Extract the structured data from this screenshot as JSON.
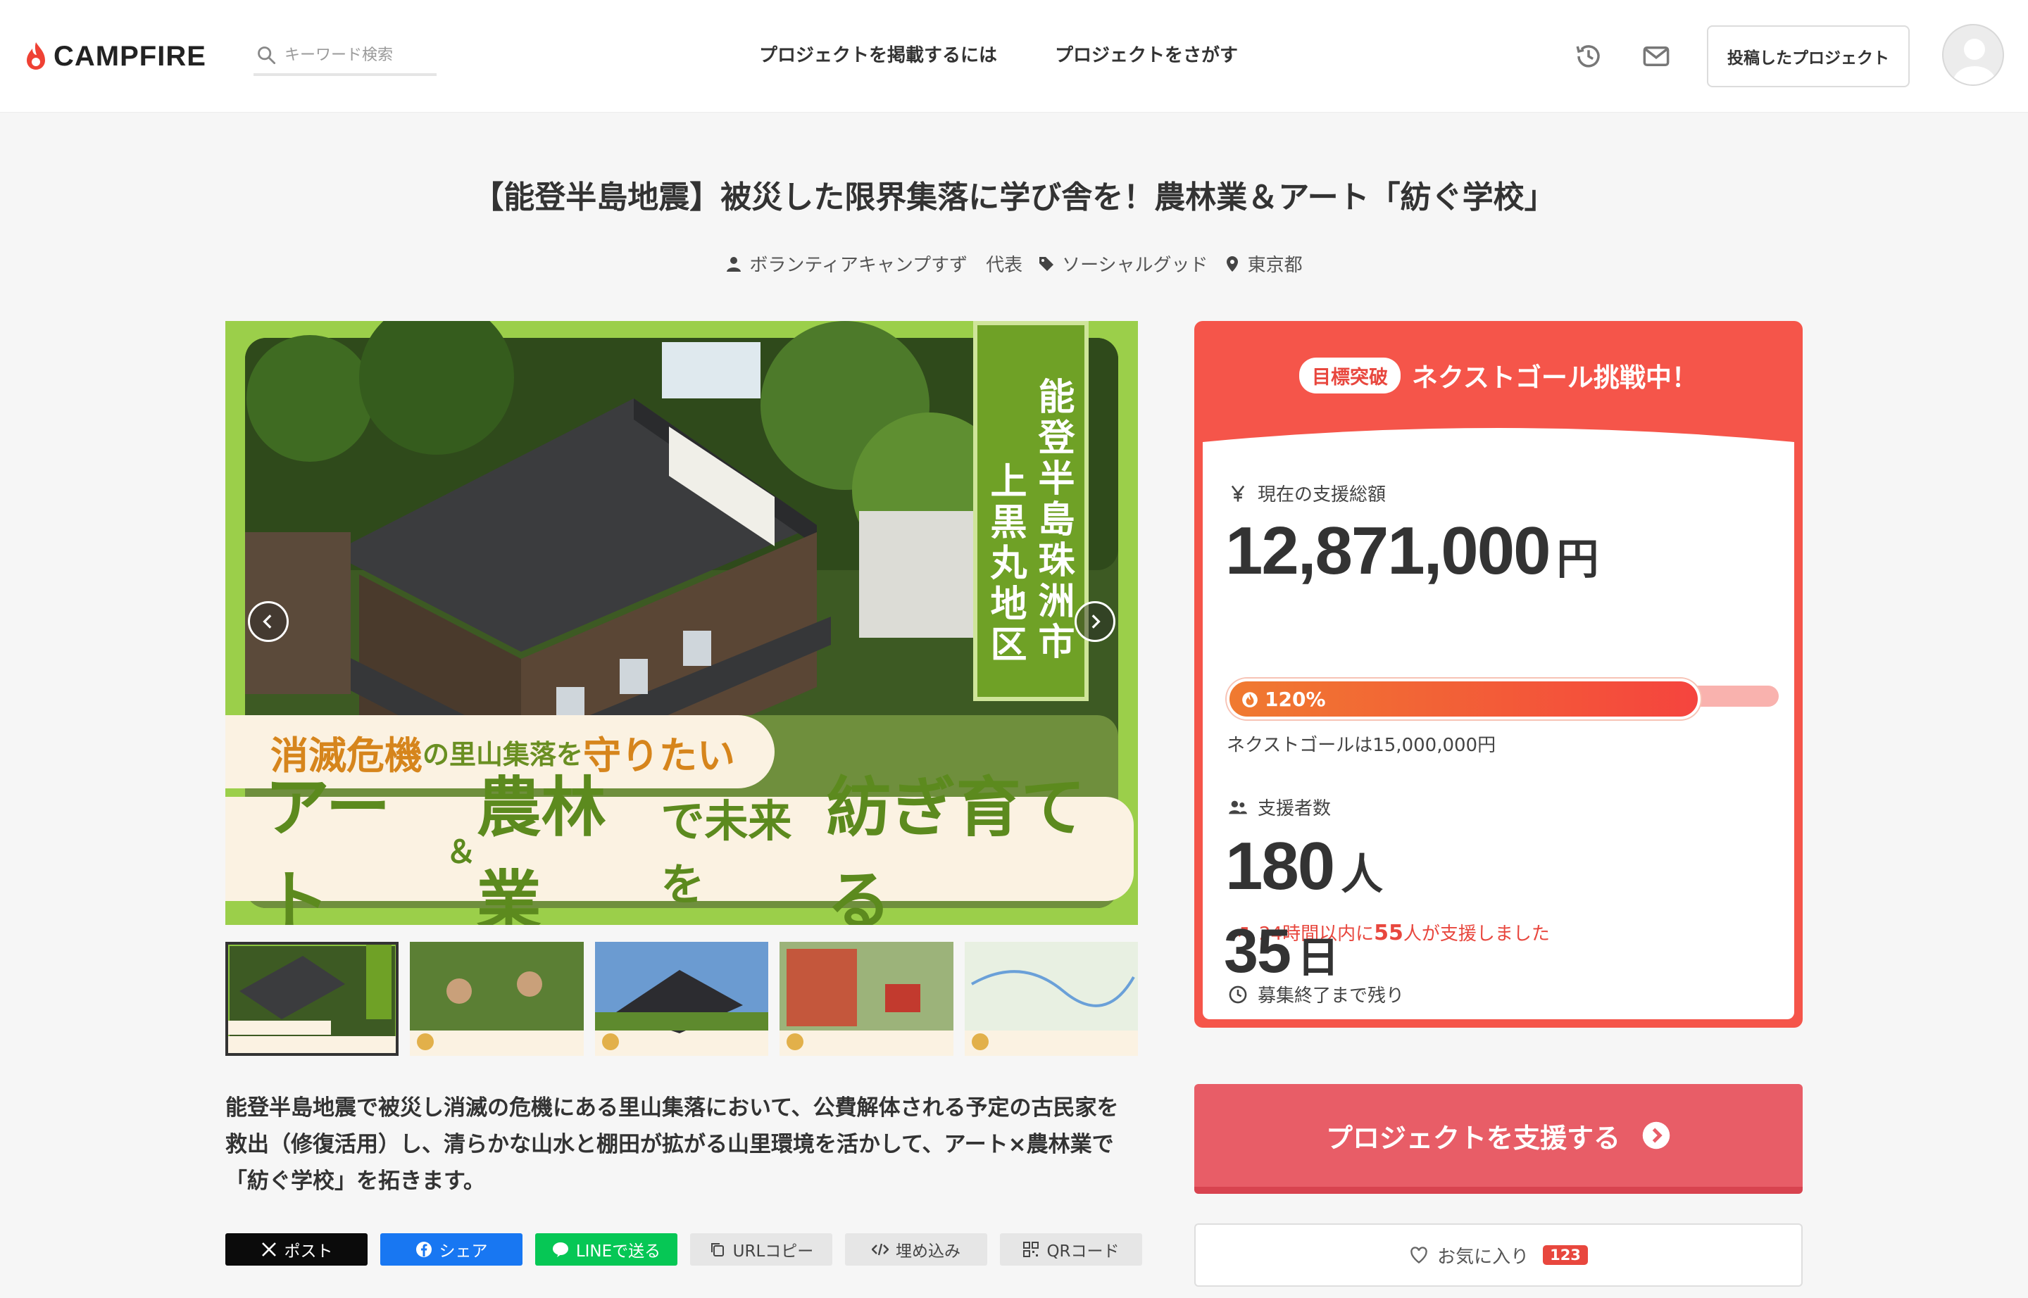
{
  "header": {
    "logo_text": "CAMPFIRE",
    "search_placeholder": "キーワード検索",
    "nav": [
      {
        "label": "プロジェクトを掲載するには"
      },
      {
        "label": "プロジェクトをさがす"
      }
    ],
    "icons": [
      "history-icon",
      "mail-icon"
    ],
    "posted_projects_label": "投稿したプロジェクト"
  },
  "project": {
    "title": "【能登半島地震】被災した限界集落に学び舎を！農林業＆アート「紡ぐ学校」",
    "owner": "ボランティアキャンプすず　代表",
    "category": "ソーシャルグッド",
    "location": "東京都"
  },
  "hero": {
    "vertical_right": "能登半島珠洲市",
    "vertical_left": "上黒丸地区",
    "banner1_big_a": "消滅危機",
    "banner1_small_a": "の里山集落",
    "banner1_small_b": "を",
    "banner1_big_b": "守りたい",
    "banner2_a": "アート",
    "banner2_amp": "＆",
    "banner2_b": "農林業",
    "banner2_c": "で未来を",
    "banner2_d": "紡ぎ育てる"
  },
  "description": "能登半島地震で被災し消滅の危機にある里山集落において、公費解体される予定の古民家を救出（修復活用）し、清らかな山水と棚田が拡がる山里環境を活かして、アート×農林業で「紡ぐ学校」を拓きます。",
  "shares": [
    {
      "label": "ポスト",
      "icon": "x-logo-icon"
    },
    {
      "label": "シェア",
      "icon": "facebook-icon"
    },
    {
      "label": "LINEで送る",
      "icon": "line-icon"
    },
    {
      "label": "URLコピー",
      "icon": "copy-icon"
    },
    {
      "label": "埋め込み",
      "icon": "code-icon"
    },
    {
      "label": "QRコード",
      "icon": "qr-icon"
    }
  ],
  "funding": {
    "badge": "目標突破",
    "headline": "ネクストゴール挑戦中！",
    "raised_label": "現在の支援総額",
    "raised_value": "12,871,000",
    "raised_unit": "円",
    "progress_percent": 120,
    "progress_label": "120%",
    "next_goal": "ネクストゴールは15,000,000円",
    "backers_label": "支援者数",
    "backers_value": "180",
    "backers_unit": "人",
    "trend_pre": "24時間以内に",
    "trend_num": "55",
    "trend_post": "人が支援しました",
    "remaining_label": "募集終了まで残り",
    "remaining_value": "35",
    "remaining_unit": "日"
  },
  "cta": {
    "label": "プロジェクトを支援する"
  },
  "favorite": {
    "label": "お気に入り",
    "count": "123"
  },
  "colors": {
    "brand_red": "#f5554a",
    "cta": "#e85d67",
    "hero_green": "#8cc63f"
  }
}
